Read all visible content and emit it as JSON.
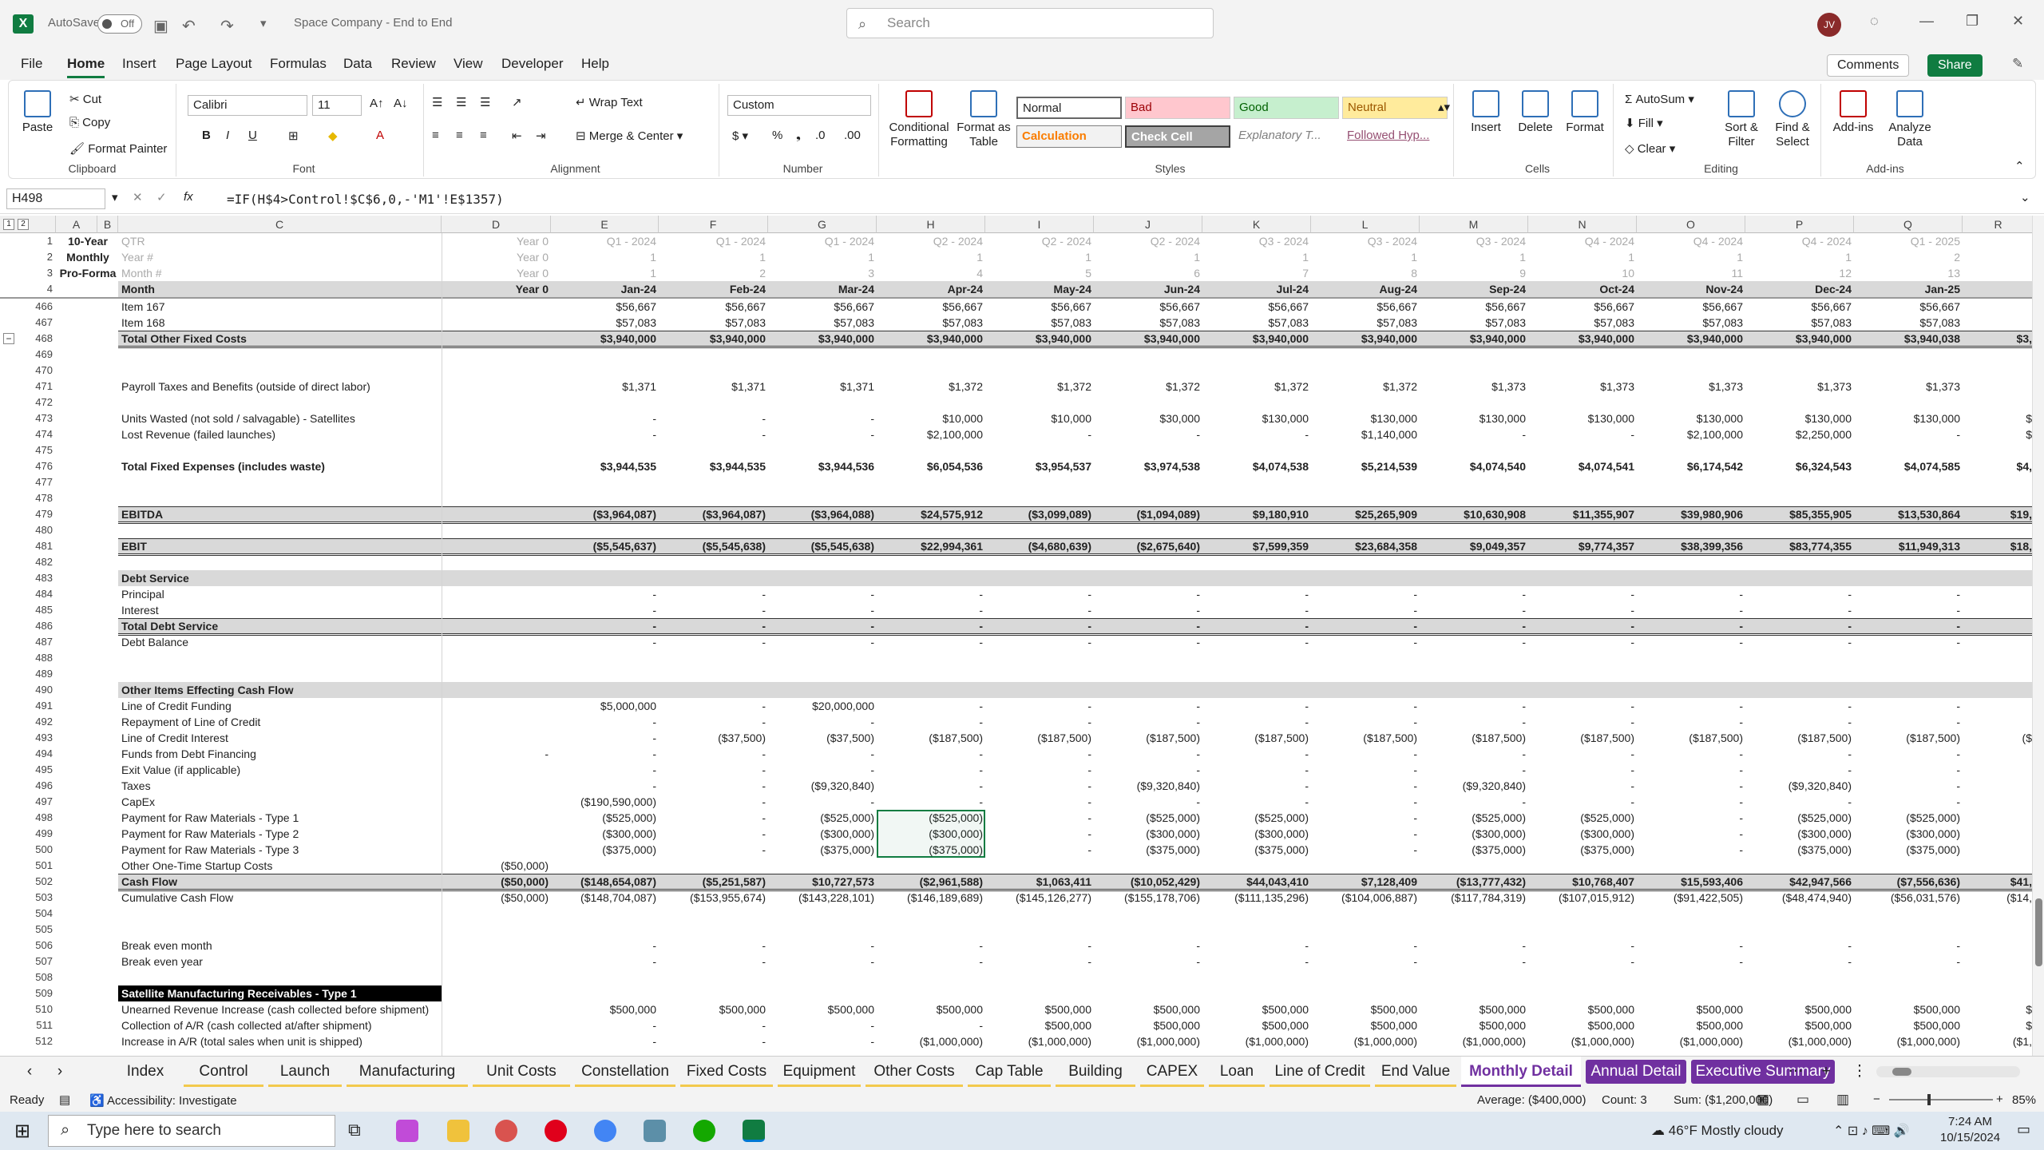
{
  "app": {
    "autosave": "AutoSave",
    "autosave_state": "Off",
    "title": "Space Company - End to End",
    "search_placeholder": "Search",
    "user_initials": "JV",
    "comments": "Comments",
    "share": "Share"
  },
  "menu": [
    "File",
    "Home",
    "Insert",
    "Page Layout",
    "Formulas",
    "Data",
    "Review",
    "View",
    "Developer",
    "Help"
  ],
  "ribbon": {
    "clipboard": {
      "paste": "Paste",
      "cut": "Cut",
      "copy": "Copy",
      "format_painter": "Format Painter",
      "label": "Clipboard"
    },
    "font": {
      "name": "Calibri",
      "size": "11",
      "label": "Font"
    },
    "alignment": {
      "wrap": "Wrap Text",
      "merge": "Merge & Center",
      "label": "Alignment"
    },
    "number": {
      "format": "Custom",
      "label": "Number"
    },
    "styles": {
      "conditional": "Conditional Formatting",
      "format_table": "Format as Table",
      "normal": "Normal",
      "bad": "Bad",
      "good": "Good",
      "neutral": "Neutral",
      "calculation": "Calculation",
      "check": "Check Cell",
      "explanatory": "Explanatory T...",
      "followed": "Followed Hyp...",
      "label": "Styles"
    },
    "cells": {
      "insert": "Insert",
      "delete": "Delete",
      "format": "Format",
      "label": "Cells"
    },
    "editing": {
      "autosum": "AutoSum",
      "fill": "Fill",
      "clear": "Clear",
      "sort": "Sort & Filter",
      "find": "Find & Select",
      "label": "Editing"
    },
    "addins": {
      "addins": "Add-ins",
      "analyze": "Analyze Data",
      "label": "Add-ins"
    }
  },
  "formula_bar": {
    "name_box": "H498",
    "formula": "=IF(H$4>Control!$C$6,0,-'M1'!E$1357)"
  },
  "columns": [
    "A",
    "B",
    "C",
    "D",
    "E",
    "F",
    "G",
    "H",
    "I",
    "J",
    "K",
    "L",
    "M",
    "N",
    "O",
    "P",
    "Q",
    "R"
  ],
  "header_rows": {
    "a": [
      "10-Year",
      "Monthly",
      "Pro-Forma"
    ],
    "labels": [
      "QTR",
      "Year #",
      "Month #"
    ],
    "qtr": [
      "Year 0",
      "Q1 - 2024",
      "Q1 - 2024",
      "Q1 - 2024",
      "Q2 - 2024",
      "Q2 - 2024",
      "Q2 - 2024",
      "Q3 - 2024",
      "Q3 - 2024",
      "Q3 - 2024",
      "Q4 - 2024",
      "Q4 - 2024",
      "Q4 - 2024",
      "Q1 - 2025"
    ],
    "year": [
      "Year 0",
      "1",
      "1",
      "1",
      "1",
      "1",
      "1",
      "1",
      "1",
      "1",
      "1",
      "1",
      "1",
      "2"
    ],
    "month": [
      "Year 0",
      "1",
      "2",
      "3",
      "4",
      "5",
      "6",
      "7",
      "8",
      "9",
      "10",
      "11",
      "12",
      "13"
    ],
    "months": [
      "Month",
      "Year 0",
      "Jan-24",
      "Feb-24",
      "Mar-24",
      "Apr-24",
      "May-24",
      "Jun-24",
      "Jul-24",
      "Aug-24",
      "Sep-24",
      "Oct-24",
      "Nov-24",
      "Dec-24",
      "Jan-25"
    ]
  },
  "rows": [
    {
      "n": "466",
      "label": "Item 167",
      "vals": [
        "",
        "$56,667",
        "$56,667",
        "$56,667",
        "$56,667",
        "$56,667",
        "$56,667",
        "$56,667",
        "$56,667",
        "$56,667",
        "$56,667",
        "$56,667",
        "$56,667",
        "$56,667"
      ]
    },
    {
      "n": "467",
      "label": "Item 168",
      "vals": [
        "",
        "$57,083",
        "$57,083",
        "$57,083",
        "$57,083",
        "$57,083",
        "$57,083",
        "$57,083",
        "$57,083",
        "$57,083",
        "$57,083",
        "$57,083",
        "$57,083",
        "$57,083"
      ]
    },
    {
      "n": "468",
      "label": "Total Other Fixed Costs",
      "bold": true,
      "band": true,
      "vals": [
        "",
        "$3,940,000",
        "$3,940,000",
        "$3,940,000",
        "$3,940,000",
        "$3,940,000",
        "$3,940,000",
        "$3,940,000",
        "$3,940,000",
        "$3,940,000",
        "$3,940,000",
        "$3,940,000",
        "$3,940,000",
        "$3,940,038",
        "$3,"
      ]
    },
    {
      "n": "469",
      "label": "",
      "vals": []
    },
    {
      "n": "470",
      "label": "",
      "vals": []
    },
    {
      "n": "471",
      "label": "Payroll Taxes and Benefits (outside of direct labor)",
      "vals": [
        "",
        "$1,371",
        "$1,371",
        "$1,371",
        "$1,372",
        "$1,372",
        "$1,372",
        "$1,372",
        "$1,372",
        "$1,373",
        "$1,373",
        "$1,373",
        "$1,373",
        "$1,373"
      ]
    },
    {
      "n": "472",
      "label": "",
      "vals": []
    },
    {
      "n": "473",
      "label": "Units Wasted (not sold / salvagable) - Satellites",
      "vals": [
        "",
        "-",
        "-",
        "-",
        "$10,000",
        "$10,000",
        "$30,000",
        "$130,000",
        "$130,000",
        "$130,000",
        "$130,000",
        "$130,000",
        "$130,000",
        "$130,000",
        "$"
      ]
    },
    {
      "n": "474",
      "label": "Lost Revenue (failed launches)",
      "vals": [
        "",
        "-",
        "-",
        "-",
        "$2,100,000",
        "-",
        "-",
        "-",
        "$1,140,000",
        "-",
        "-",
        "$2,100,000",
        "$2,250,000",
        "-",
        "$"
      ]
    },
    {
      "n": "475",
      "label": "",
      "vals": []
    },
    {
      "n": "476",
      "label": "Total Fixed Expenses (includes waste)",
      "bold": true,
      "vals": [
        "",
        "$3,944,535",
        "$3,944,535",
        "$3,944,536",
        "$6,054,536",
        "$3,954,537",
        "$3,974,538",
        "$4,074,538",
        "$5,214,539",
        "$4,074,540",
        "$4,074,541",
        "$6,174,542",
        "$6,324,543",
        "$4,074,585",
        "$4,"
      ]
    },
    {
      "n": "477",
      "label": "",
      "vals": []
    },
    {
      "n": "478",
      "label": "",
      "vals": []
    },
    {
      "n": "479",
      "label": "EBITDA",
      "bold": true,
      "band": true,
      "vals": [
        "",
        "($3,964,087)",
        "($3,964,087)",
        "($3,964,088)",
        "$24,575,912",
        "($3,099,089)",
        "($1,094,089)",
        "$9,180,910",
        "$25,265,909",
        "$10,630,908",
        "$11,355,907",
        "$39,980,906",
        "$85,355,905",
        "$13,530,864",
        "$19,"
      ]
    },
    {
      "n": "480",
      "label": "",
      "vals": []
    },
    {
      "n": "481",
      "label": "EBIT",
      "bold": true,
      "band": true,
      "vals": [
        "",
        "($5,545,637)",
        "($5,545,638)",
        "($5,545,638)",
        "$22,994,361",
        "($4,680,639)",
        "($2,675,640)",
        "$7,599,359",
        "$23,684,358",
        "$9,049,357",
        "$9,774,357",
        "$38,399,356",
        "$83,774,355",
        "$11,949,313",
        "$18,"
      ]
    },
    {
      "n": "482",
      "label": "",
      "vals": []
    },
    {
      "n": "483",
      "label": "Debt Service",
      "bold": true,
      "section": true,
      "vals": []
    },
    {
      "n": "484",
      "label": "Principal",
      "vals": [
        "",
        "-",
        "-",
        "-",
        "-",
        "-",
        "-",
        "-",
        "-",
        "-",
        "-",
        "-",
        "-",
        "-"
      ]
    },
    {
      "n": "485",
      "label": "Interest",
      "vals": [
        "",
        "-",
        "-",
        "-",
        "-",
        "-",
        "-",
        "-",
        "-",
        "-",
        "-",
        "-",
        "-",
        "-"
      ]
    },
    {
      "n": "486",
      "label": "Total Debt Service",
      "bold": true,
      "band": true,
      "vals": [
        "",
        "-",
        "-",
        "-",
        "-",
        "-",
        "-",
        "-",
        "-",
        "-",
        "-",
        "-",
        "-",
        "-"
      ]
    },
    {
      "n": "487",
      "label": "Debt Balance",
      "vals": [
        "",
        "-",
        "-",
        "-",
        "-",
        "-",
        "-",
        "-",
        "-",
        "-",
        "-",
        "-",
        "-",
        "-"
      ]
    },
    {
      "n": "488",
      "label": "",
      "vals": []
    },
    {
      "n": "489",
      "label": "",
      "vals": []
    },
    {
      "n": "490",
      "label": "Other Items Effecting Cash Flow",
      "bold": true,
      "section": true,
      "vals": []
    },
    {
      "n": "491",
      "label": "Line of Credit Funding",
      "vals": [
        "",
        "$5,000,000",
        "-",
        "$20,000,000",
        "-",
        "-",
        "-",
        "-",
        "-",
        "-",
        "-",
        "-",
        "-",
        "-"
      ]
    },
    {
      "n": "492",
      "label": "Repayment of Line of Credit",
      "vals": [
        "",
        "-",
        "-",
        "-",
        "-",
        "-",
        "-",
        "-",
        "-",
        "-",
        "-",
        "-",
        "-",
        "-"
      ]
    },
    {
      "n": "493",
      "label": "Line of Credit Interest",
      "vals": [
        "",
        "-",
        "($37,500)",
        "($37,500)",
        "($187,500)",
        "($187,500)",
        "($187,500)",
        "($187,500)",
        "($187,500)",
        "($187,500)",
        "($187,500)",
        "($187,500)",
        "($187,500)",
        "($187,500)",
        "($"
      ]
    },
    {
      "n": "494",
      "label": "Funds from Debt Financing",
      "vals": [
        "-",
        "-",
        "-",
        "-",
        "-",
        "-",
        "-",
        "-",
        "-",
        "-",
        "-",
        "-",
        "-",
        "-"
      ]
    },
    {
      "n": "495",
      "label": "Exit Value (if applicable)",
      "vals": [
        "",
        "-",
        "-",
        "-",
        "-",
        "-",
        "-",
        "-",
        "-",
        "-",
        "-",
        "-",
        "-",
        "-"
      ]
    },
    {
      "n": "496",
      "label": "Taxes",
      "vals": [
        "",
        "-",
        "-",
        "($9,320,840)",
        "-",
        "-",
        "($9,320,840)",
        "-",
        "-",
        "($9,320,840)",
        "-",
        "-",
        "($9,320,840)",
        "-"
      ]
    },
    {
      "n": "497",
      "label": "CapEx",
      "vals": [
        "",
        "($190,590,000)",
        "-",
        "-",
        "-",
        "-",
        "-",
        "-",
        "-",
        "-",
        "-",
        "-",
        "-",
        "-"
      ]
    },
    {
      "n": "498",
      "label": "Payment for Raw Materials - Type 1",
      "vals": [
        "",
        "($525,000)",
        "-",
        "($525,000)",
        "($525,000)",
        "-",
        "($525,000)",
        "($525,000)",
        "-",
        "($525,000)",
        "($525,000)",
        "-",
        "($525,000)",
        "($525,000)"
      ]
    },
    {
      "n": "499",
      "label": "Payment for Raw Materials - Type 2",
      "vals": [
        "",
        "($300,000)",
        "-",
        "($300,000)",
        "($300,000)",
        "-",
        "($300,000)",
        "($300,000)",
        "-",
        "($300,000)",
        "($300,000)",
        "-",
        "($300,000)",
        "($300,000)"
      ]
    },
    {
      "n": "500",
      "label": "Payment for Raw Materials - Type 3",
      "vals": [
        "",
        "($375,000)",
        "-",
        "($375,000)",
        "($375,000)",
        "-",
        "($375,000)",
        "($375,000)",
        "-",
        "($375,000)",
        "($375,000)",
        "-",
        "($375,000)",
        "($375,000)"
      ]
    },
    {
      "n": "501",
      "label": "Other One-Time Startup Costs",
      "vals": [
        "($50,000)",
        "",
        "",
        "",
        "",
        "",
        "",
        "",
        "",
        "",
        "",
        "",
        "",
        ""
      ]
    },
    {
      "n": "502",
      "label": "Cash Flow",
      "bold": true,
      "band": true,
      "vals": [
        "($50,000)",
        "($148,654,087)",
        "($5,251,587)",
        "$10,727,573",
        "($2,961,588)",
        "$1,063,411",
        "($10,052,429)",
        "$44,043,410",
        "$7,128,409",
        "($13,777,432)",
        "$10,768,407",
        "$15,593,406",
        "$42,947,566",
        "($7,556,636)",
        "$41,"
      ]
    },
    {
      "n": "503",
      "label": "Cumulative Cash Flow",
      "vals": [
        "($50,000)",
        "($148,704,087)",
        "($153,955,674)",
        "($143,228,101)",
        "($146,189,689)",
        "($145,126,277)",
        "($155,178,706)",
        "($111,135,296)",
        "($104,006,887)",
        "($117,784,319)",
        "($107,015,912)",
        "($91,422,505)",
        "($48,474,940)",
        "($56,031,576)",
        "($14,"
      ]
    },
    {
      "n": "504",
      "label": "",
      "vals": []
    },
    {
      "n": "505",
      "label": "",
      "vals": []
    },
    {
      "n": "506",
      "label": "Break even month",
      "vals": [
        "",
        "-",
        "-",
        "-",
        "-",
        "-",
        "-",
        "-",
        "-",
        "-",
        "-",
        "-",
        "-",
        "-"
      ]
    },
    {
      "n": "507",
      "label": "Break even year",
      "vals": [
        "",
        "-",
        "-",
        "-",
        "-",
        "-",
        "-",
        "-",
        "-",
        "-",
        "-",
        "-",
        "-",
        "-"
      ]
    },
    {
      "n": "508",
      "label": "",
      "vals": []
    },
    {
      "n": "509",
      "label": "Satellite Manufacturing Receivables - Type 1",
      "black": true,
      "vals": []
    },
    {
      "n": "510",
      "label": "Unearned Revenue Increase (cash collected before shipment)",
      "vals": [
        "",
        "$500,000",
        "$500,000",
        "$500,000",
        "$500,000",
        "$500,000",
        "$500,000",
        "$500,000",
        "$500,000",
        "$500,000",
        "$500,000",
        "$500,000",
        "$500,000",
        "$500,000",
        "$"
      ]
    },
    {
      "n": "511",
      "label": "Collection of A/R (cash collected at/after shipment)",
      "vals": [
        "",
        "-",
        "-",
        "-",
        "-",
        "$500,000",
        "$500,000",
        "$500,000",
        "$500,000",
        "$500,000",
        "$500,000",
        "$500,000",
        "$500,000",
        "$500,000",
        "$"
      ]
    },
    {
      "n": "512",
      "label": "Increase in A/R (total sales when unit is shipped)",
      "vals": [
        "",
        "-",
        "-",
        "-",
        "($1,000,000)",
        "($1,000,000)",
        "($1,000,000)",
        "($1,000,000)",
        "($1,000,000)",
        "($1,000,000)",
        "($1,000,000)",
        "($1,000,000)",
        "($1,000,000)",
        "($1,000,000)",
        "($1,"
      ]
    }
  ],
  "sheets": [
    {
      "name": "Index",
      "style": "white"
    },
    {
      "name": "Control",
      "style": "yellow"
    },
    {
      "name": "Launch",
      "style": "yellow"
    },
    {
      "name": "Manufacturing",
      "style": "yellow"
    },
    {
      "name": "Unit Costs",
      "style": "yellow"
    },
    {
      "name": "Constellation",
      "style": "yellow"
    },
    {
      "name": "Fixed Costs",
      "style": "yellow"
    },
    {
      "name": "Equipment",
      "style": "yellow"
    },
    {
      "name": "Other Costs",
      "style": "yellow"
    },
    {
      "name": "Cap Table",
      "style": "yellow"
    },
    {
      "name": "Building",
      "style": "yellow"
    },
    {
      "name": "CAPEX",
      "style": "yellow"
    },
    {
      "name": "Loan",
      "style": "yellow"
    },
    {
      "name": "Line of Credit",
      "style": "yellow"
    },
    {
      "name": "End Value",
      "style": "yellow"
    },
    {
      "name": "Monthly Detail",
      "style": "active"
    },
    {
      "name": "Annual Detail",
      "style": "purple"
    },
    {
      "name": "Executive Summary",
      "style": "purple"
    }
  ],
  "status": {
    "ready": "Ready",
    "accessibility": "Accessibility: Investigate",
    "average": "Average: ($400,000)",
    "count": "Count: 3",
    "sum": "Sum: ($1,200,000)",
    "zoom": "85%"
  },
  "taskbar": {
    "search": "Type here to search",
    "weather": "46°F  Mostly cloudy",
    "time": "7:24 AM",
    "date": "10/15/2024"
  }
}
